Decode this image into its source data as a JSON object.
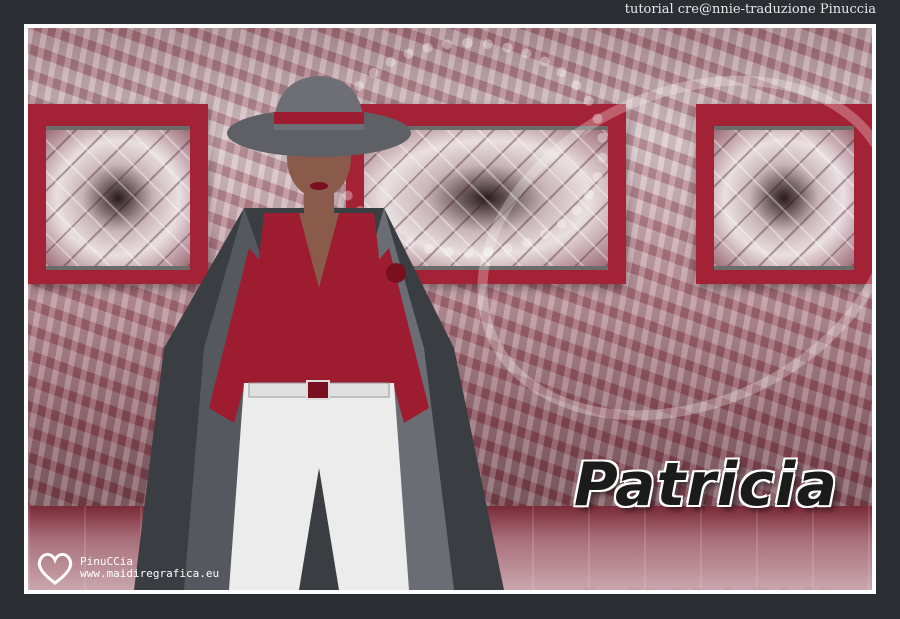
{
  "header": {
    "credit": "tutorial cre@nnie-traduzione Pinuccia"
  },
  "artwork": {
    "name_logo": "Patricia"
  },
  "watermark": {
    "author": "PinuCCia",
    "site": "www.maidiregrafica.eu"
  },
  "colors": {
    "page_bg": "#2b2f34",
    "accent_red": "#a42235",
    "frame": "#ffffff"
  },
  "icons": {
    "watermark": "heart-icon"
  }
}
